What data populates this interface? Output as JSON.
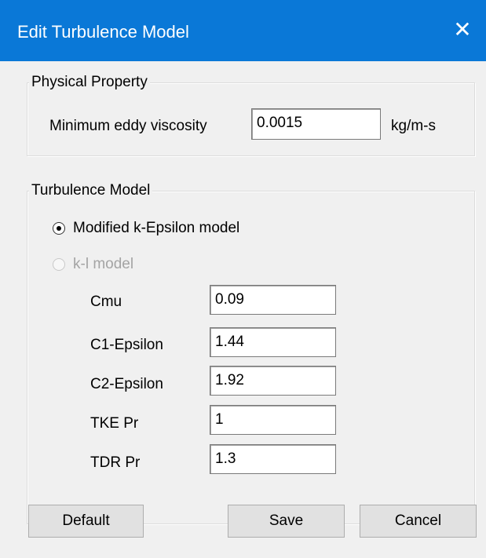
{
  "window": {
    "title": "Edit Turbulence Model",
    "close_icon": "close-icon"
  },
  "physical_property": {
    "group_label": "Physical Property",
    "min_eddy_label": "Minimum eddy viscosity",
    "min_eddy_value": "0.0015",
    "min_eddy_unit": "kg/m-s"
  },
  "turbulence_model": {
    "group_label": "Turbulence Model",
    "options": [
      {
        "label": "Modified k-Epsilon model",
        "selected": true,
        "enabled": true
      },
      {
        "label": "k-l model",
        "selected": false,
        "enabled": false
      }
    ],
    "params": [
      {
        "label": "Cmu",
        "value": "0.09"
      },
      {
        "label": "C1-Epsilon",
        "value": "1.44"
      },
      {
        "label": "C2-Epsilon",
        "value": "1.92"
      },
      {
        "label": "TKE Pr",
        "value": "1"
      },
      {
        "label": "TDR Pr",
        "value": "1.3"
      }
    ]
  },
  "buttons": {
    "default_label": "Default",
    "save_label": "Save",
    "cancel_label": "Cancel"
  },
  "colors": {
    "titlebar": "#0a78d7",
    "background": "#f0f0f0"
  }
}
